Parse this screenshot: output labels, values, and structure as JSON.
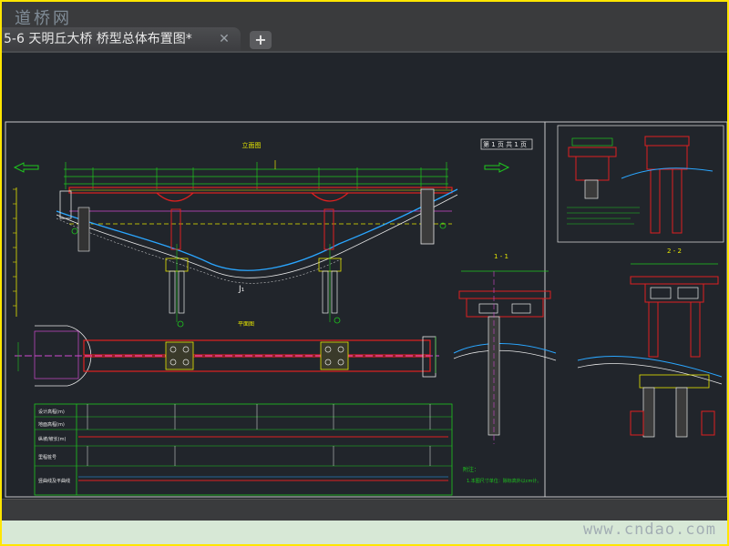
{
  "watermark_top": "道桥网",
  "watermark_bottom": "www.cndao.com",
  "tab": {
    "title": "5-6 天明丘大桥 桥型总体布置图*",
    "close_glyph": "✕",
    "new_glyph": "+"
  },
  "drawing": {
    "elevation_title": "立面图",
    "plan_title": "平面图",
    "section_1_title": "1 - 1",
    "section_2_title": "2 - 2",
    "page_label": "第 1 页  共 1 页",
    "notes_title": "附注：",
    "notes_line": "1.本图尺寸单位：除标高外以cm计。",
    "curve_label": "J₁",
    "table_rows": [
      "设计高程(m)",
      "地面高程(m)",
      "纵坡/坡长(m)",
      "里程桩号",
      "竖曲线及平曲线"
    ]
  },
  "colors": {
    "frame": "#ffe600",
    "cad_bg": "#21252b",
    "green": "#1ec81e",
    "red": "#e02020",
    "yellow": "#e6e600",
    "cyan": "#2aa6ff",
    "magenta": "#d04ad0",
    "white": "#e8e8e8"
  }
}
